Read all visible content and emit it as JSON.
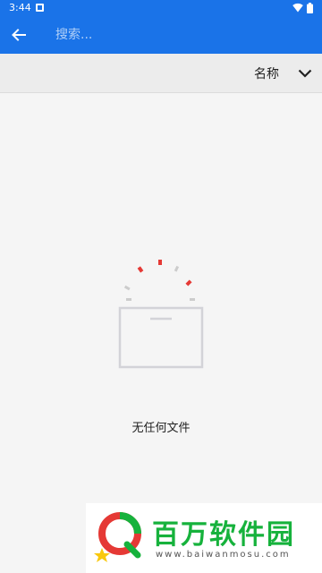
{
  "status_bar": {
    "time": "3:44",
    "icons": [
      "notification-icon",
      "wifi-icon",
      "battery-icon"
    ]
  },
  "app_bar": {
    "back_icon": "arrow-left-icon",
    "search_placeholder": "搜索...",
    "search_value": ""
  },
  "sort_bar": {
    "label": "名称",
    "icon": "chevron-down-icon"
  },
  "empty_state": {
    "message": "无任何文件",
    "illustration": "empty-box-icon"
  },
  "watermark": {
    "title": "百万软件园",
    "url": "www.baiwanmosu.com"
  },
  "colors": {
    "primary": "#1a73e8",
    "background": "#f5f5f5",
    "sort_bar": "#ececec",
    "accent_red": "#e53935",
    "watermark_green": "#16b23c"
  }
}
